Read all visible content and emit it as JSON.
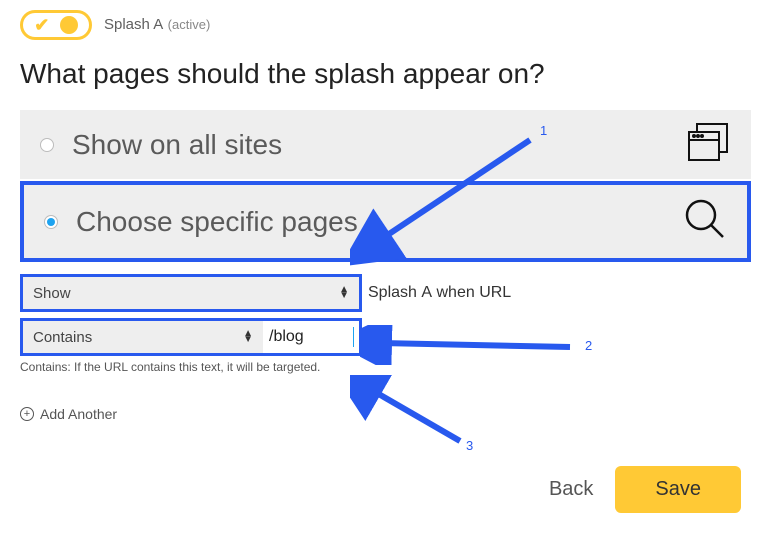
{
  "header": {
    "splash_name": "Splash A",
    "status": "(active)"
  },
  "title": "What pages should the splash appear on?",
  "options": {
    "all": {
      "label": "Show on all sites",
      "selected": false
    },
    "specific": {
      "label": "Choose specific pages",
      "selected": true
    }
  },
  "rule": {
    "action_select": "Show",
    "mid_prefix": "Splash ",
    "mid_bold": "A",
    "mid_suffix": " when URL",
    "match_select": "Contains",
    "url_value": "/blog",
    "help_bold": "Contains:",
    "help_text": " If the URL contains this text, it will be targeted."
  },
  "add_another": "Add Another",
  "buttons": {
    "back": "Back",
    "save": "Save"
  },
  "annotations": {
    "n1": "1",
    "n2": "2",
    "n3": "3"
  }
}
